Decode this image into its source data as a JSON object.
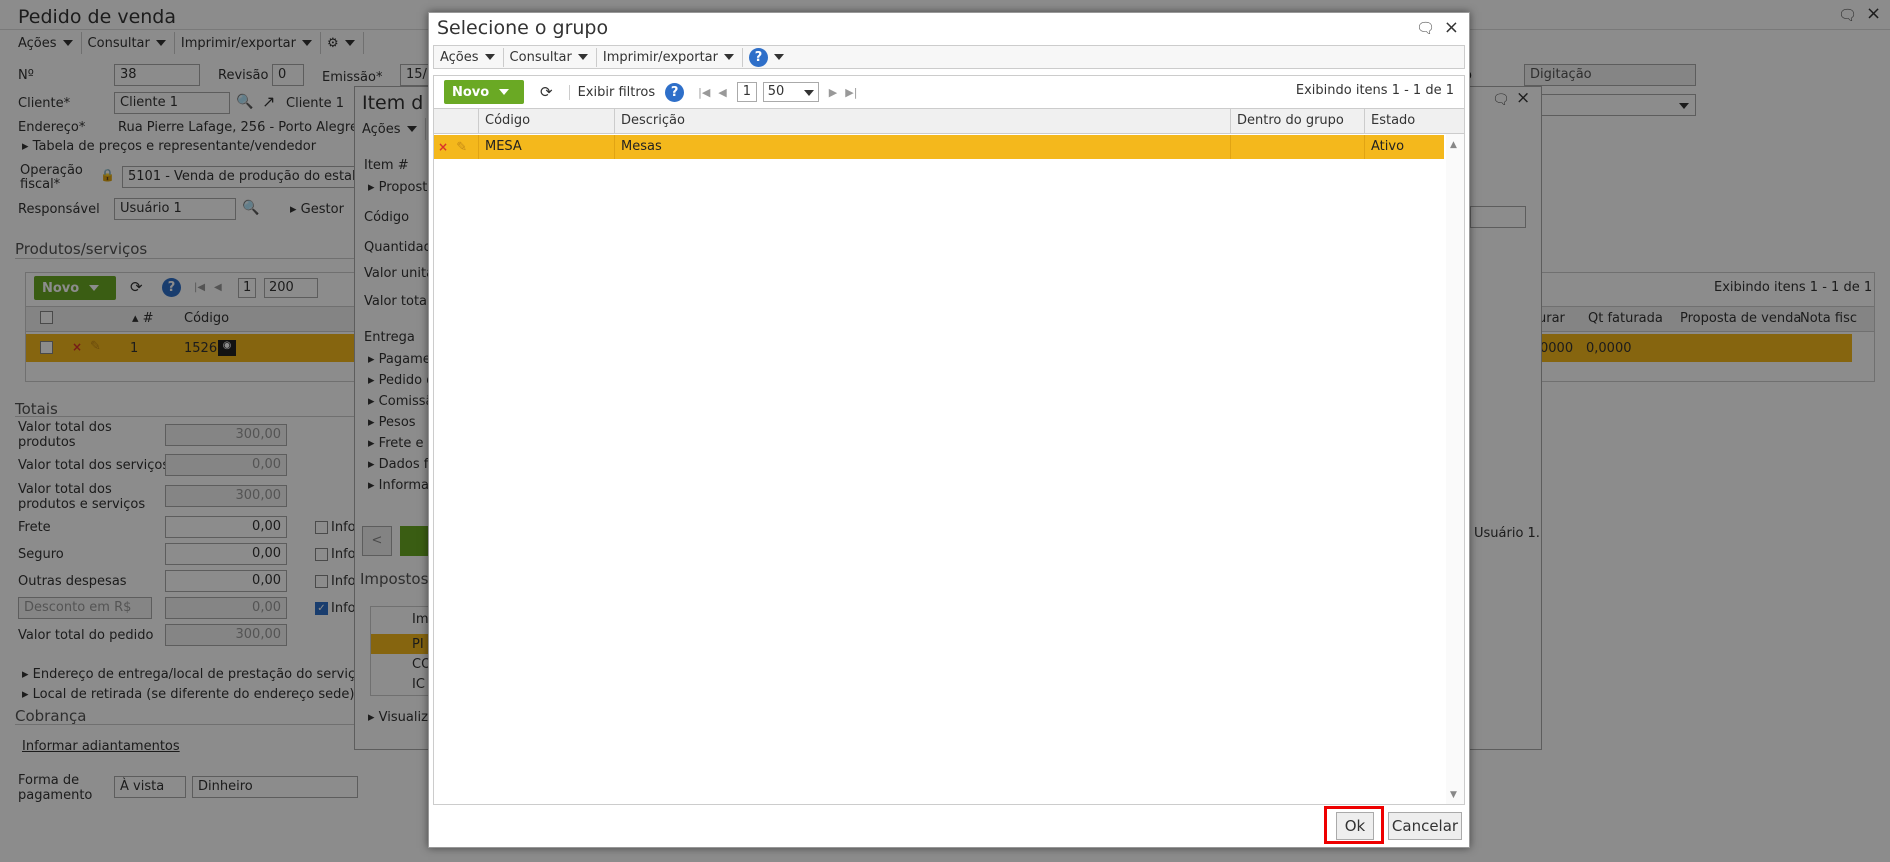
{
  "background": {
    "page_title": "Pedido de venda",
    "menu": [
      "Ações",
      "Consultar",
      "Imprimir/exportar"
    ],
    "fields": {
      "numero_label": "Nº",
      "numero_value": "38",
      "revisao_label": "Revisão",
      "revisao_value": "0",
      "emissao_label": "Emissão*",
      "emissao_value": "15/",
      "cliente_label": "Cliente*",
      "cliente_value": "Cliente 1",
      "cliente_link": "Cliente 1",
      "endereco_label": "Endereço*",
      "endereco_value": "Rua Pierre Lafage, 256 - Porto Alegre/",
      "tabela_precos": "Tabela de preços e representante/vendedor",
      "operacao_label_1": "Operação",
      "operacao_label_2": "fiscal*",
      "operacao_value": "5101 - Venda de produção do estabel",
      "responsavel_label": "Responsável",
      "responsavel_value": "Usuário 1",
      "gestor_label": "Gestor",
      "situacao_value": "Digitação",
      "situacao_label_fragment": "o"
    },
    "produtos": {
      "section_title": "Produtos/serviços",
      "novo_label": "Novo",
      "page_number": "1",
      "page_size": "200",
      "exibindo": "Exibindo itens 1 - 1 de 1",
      "col_num": "#",
      "col_codigo": "Código",
      "col_faturar_fragment": "urar",
      "col_qt_faturada": "Qt faturada",
      "col_proposta": "Proposta de venda",
      "col_nota": "Nota fisc",
      "row_num": "1",
      "row_codigo": "1526",
      "row_faturar": "0000",
      "row_qt_faturada": "0,0000"
    },
    "totais": {
      "section_title": "Totais",
      "rows": [
        {
          "label_1": "Valor total dos",
          "label_2": "produtos",
          "value": "300,00"
        },
        {
          "label_1": "Valor total dos serviços",
          "label_2": "",
          "value": "0,00"
        },
        {
          "label_1": "Valor total dos",
          "label_2": "produtos e serviços",
          "value": "300,00"
        },
        {
          "label_1": "Frete",
          "label_2": "",
          "value": "0,00"
        },
        {
          "label_1": "Seguro",
          "label_2": "",
          "value": "0,00"
        },
        {
          "label_1": "Outras despesas",
          "label_2": "",
          "value": "0,00"
        },
        {
          "label_1": "Desconto em R$",
          "label_2": "",
          "value": "0,00"
        },
        {
          "label_1": "Valor total do pedido",
          "label_2": "",
          "value": "300,00"
        }
      ],
      "info_fragment": "Info",
      "endereco_entrega": "Endereço de entrega/local de prestação do serviço (s",
      "local_retirada": "Local de retirada (se diferente do endereço sede)"
    },
    "cobranca": {
      "section_title": "Cobrança",
      "adiantamentos": "Informar adiantamentos",
      "forma_label_1": "Forma de",
      "forma_label_2": "pagamento",
      "forma_value": "À vista",
      "meio_value": "Dinheiro"
    },
    "item_dialog": {
      "title_fragment": "Item d",
      "acoes": "Ações",
      "item_label": "Item #",
      "proposta": "Propost",
      "codigo": "Código",
      "quantidade": "Quantidad",
      "valor_unit": "Valor unitá",
      "valor_total": "Valor total",
      "entrega": "Entrega",
      "pagamento": "Pagame",
      "pedido": "Pedido d",
      "comissao": "Comissã",
      "pesos": "Pesos",
      "frete": "Frete e",
      "dados": "Dados fi",
      "informa": "Informa",
      "impostos": "Impostos",
      "imp_col": "Im",
      "imp_rows": [
        "PI",
        "CO",
        "IC"
      ],
      "visualiza": "Visualiza",
      "usuario": "Usuário 1."
    }
  },
  "modal": {
    "title": "Selecione o grupo",
    "menu": [
      "Ações",
      "Consultar",
      "Imprimir/exportar"
    ],
    "toolbar": {
      "novo_label": "Novo",
      "exibir_filtros": "Exibir filtros",
      "page_number": "1",
      "page_size": "50",
      "exibindo": "Exibindo itens 1 - 1 de 1"
    },
    "columns": [
      "Código",
      "Descrição",
      "Dentro do grupo",
      "Estado"
    ],
    "rows": [
      {
        "codigo": "MESA",
        "descricao": "Mesas",
        "dentro": "",
        "estado": "Ativo"
      }
    ],
    "ok_label": "Ok",
    "cancel_label": "Cancelar"
  },
  "colors": {
    "selected_row": "#f4b81c",
    "green_button": "#6aa924",
    "help_icon": "#2e6fc9",
    "highlight_border": "#e00000"
  }
}
